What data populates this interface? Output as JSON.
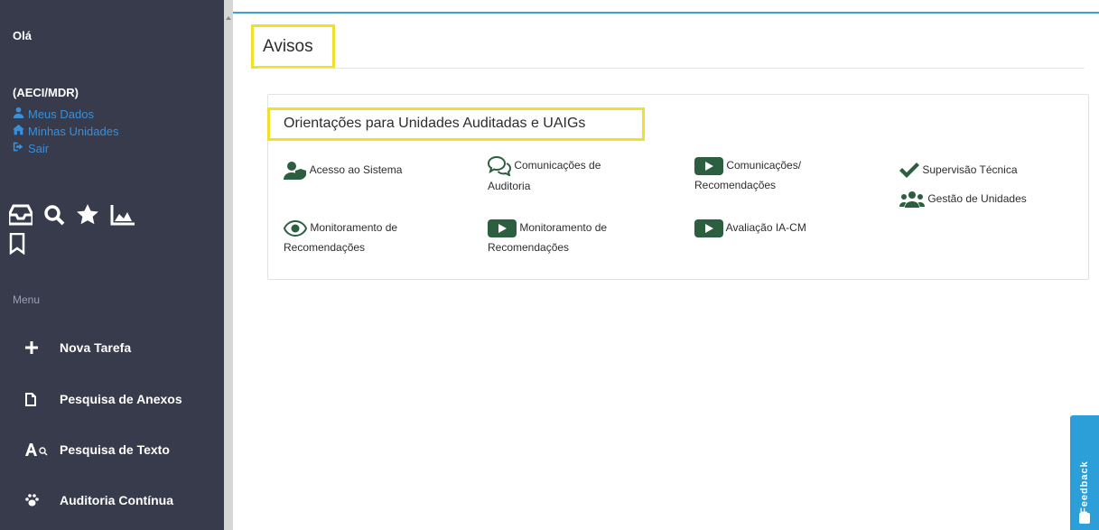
{
  "sidebar": {
    "greeting": "Olá",
    "user_org": "(AECI/MDR)",
    "links": [
      {
        "label": "Meus Dados",
        "icon": "user-icon"
      },
      {
        "label": "Minhas Unidades",
        "icon": "home-icon"
      },
      {
        "label": "Sair",
        "icon": "sign-out-icon"
      }
    ],
    "quick_icons": [
      "inbox-icon",
      "search-icon",
      "star-icon",
      "chart-icon",
      "bookmark-icon"
    ],
    "menu_label": "Menu",
    "menu": [
      {
        "label": "Nova Tarefa",
        "icon": "plus-icon"
      },
      {
        "label": "Pesquisa de Anexos",
        "icon": "file-icon"
      },
      {
        "label": "Pesquisa de Texto",
        "icon": "text-search-icon"
      },
      {
        "label": "Auditoria Contínua",
        "icon": "paw-icon"
      }
    ]
  },
  "main": {
    "title": "Avisos",
    "panel": {
      "title": "Orientações para Unidades Auditadas e UAIGs",
      "items": [
        {
          "label": "Acesso ao Sistema",
          "icon": "user-shield-icon"
        },
        {
          "label_1": "Comunicações de",
          "label_2": "Auditoria",
          "icon": "comments-icon"
        },
        {
          "label_1": "Comunicações/",
          "label_2": "Recomendações",
          "icon": "video-play-icon"
        },
        {
          "label": "Supervisão Técnica",
          "icon": "check-icon"
        },
        {
          "label": "Gestão de Unidades",
          "icon": "users-icon"
        },
        {
          "label_1": "Monitoramento de",
          "label_2": "Recomendações",
          "icon": "eye-icon"
        },
        {
          "label_1": "Monitoramento de",
          "label_2": "Recomendações",
          "icon": "video-play-icon"
        },
        {
          "label": "Avaliação IA-CM",
          "icon": "video-play-icon"
        }
      ]
    }
  },
  "feedback": {
    "label": "Feedback"
  },
  "colors": {
    "sidebar_bg": "#373b4c",
    "link_blue": "#3a8fd8",
    "highlight_yellow": "#f0e02c",
    "icon_green": "#2c5f3f",
    "feedback_blue": "#2c9fd8"
  }
}
